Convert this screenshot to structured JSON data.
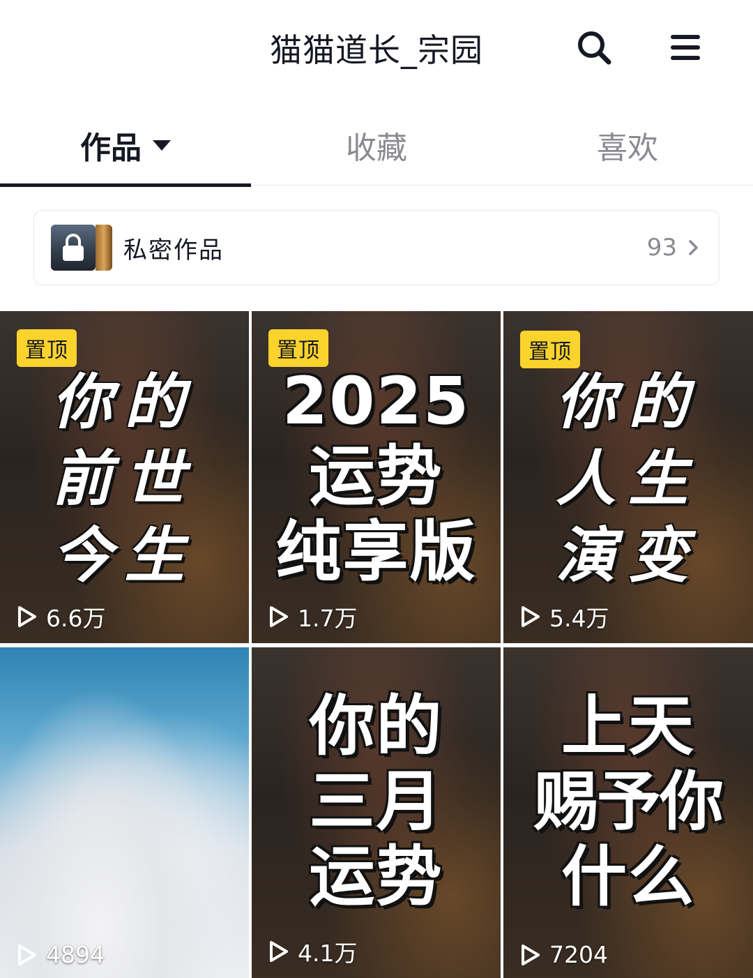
{
  "header": {
    "title": "猫猫道长_宗园",
    "search_icon": "search-icon",
    "menu_icon": "hamburger-menu-icon"
  },
  "tabs": [
    {
      "label": "作品",
      "active": true
    },
    {
      "label": "收藏",
      "active": false
    },
    {
      "label": "喜欢",
      "active": false
    }
  ],
  "private": {
    "label": "私密作品",
    "count": "93"
  },
  "pin_label": "置顶",
  "videos": [
    {
      "pinned": true,
      "cover_lines": [
        "你的",
        "前世",
        "今生"
      ],
      "views": "6.6万"
    },
    {
      "pinned": true,
      "cover_lines": [
        "2025",
        "运势",
        "纯享版"
      ],
      "views": "1.7万"
    },
    {
      "pinned": true,
      "cover_lines": [
        "你的",
        "人生",
        "演变"
      ],
      "views": "5.4万"
    },
    {
      "pinned": false,
      "cover_lines": [],
      "views": "4894"
    },
    {
      "pinned": false,
      "cover_lines": [
        "你的",
        "三月",
        "运势"
      ],
      "views": "4.1万"
    },
    {
      "pinned": false,
      "cover_lines": [
        "上天",
        "赐予你",
        "什么"
      ],
      "views": "7204"
    }
  ],
  "colors": {
    "accent_yellow": "#fbd32d",
    "text_primary": "#161823",
    "text_secondary": "#8a8b91"
  }
}
